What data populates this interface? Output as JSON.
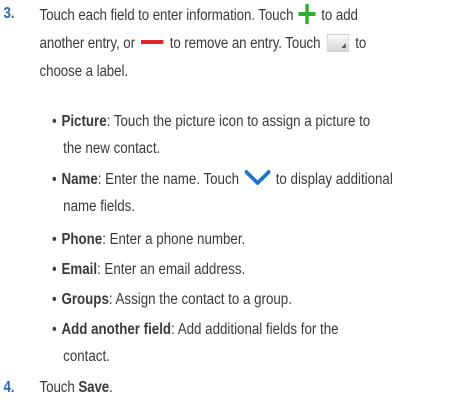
{
  "steps": [
    {
      "number": "3.",
      "line1_a": "Touch each field to enter information. Touch",
      "line1_b": "to add",
      "line2_a": "another entry, or",
      "line2_b": "to remove an entry. Touch",
      "line2_c": "to",
      "line3": "choose a label."
    },
    {
      "number": "4.",
      "text": "Touch ",
      "bold": "Save",
      "end": "."
    }
  ],
  "bullets": [
    {
      "dot": "•",
      "term": "Picture",
      "text": ": Touch the picture icon to assign a picture to",
      "cont": "the new contact."
    },
    {
      "dot": "•",
      "term": "Name",
      "text_a": ": Enter the name. Touch",
      "text_b": "to display additional",
      "cont": "name fields."
    },
    {
      "dot": "•",
      "term": "Phone",
      "text": ": Enter a phone number."
    },
    {
      "dot": "•",
      "term": "Email",
      "text": ": Enter an email address."
    },
    {
      "dot": "•",
      "term": "Groups",
      "text": ": Assign the contact to a group."
    },
    {
      "dot": "•",
      "term": "Add another field",
      "text": ": Add additional fields for the",
      "cont": "contact."
    }
  ],
  "icons": {
    "add": "plus-icon",
    "remove": "minus-icon",
    "label": "label-dropdown-icon",
    "expand": "chevron-down-icon"
  },
  "colors": {
    "step_number": "#2a68ad",
    "plus": "#2fb12f",
    "minus": "#e0242b",
    "chevron": "#1e73c8",
    "text": "#3a3a3a"
  }
}
